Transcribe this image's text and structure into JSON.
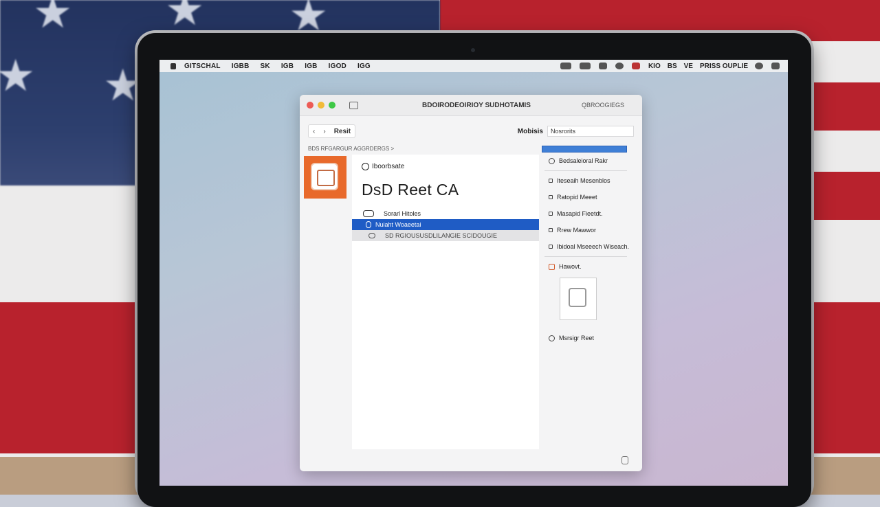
{
  "menubar": {
    "items": [
      "GITSCHAL",
      "IGBB",
      "SK",
      "IGB",
      "IGB",
      "IGOD",
      "IGG"
    ],
    "status_text": [
      "KIO",
      "BS",
      "VE",
      "PRISS OUPLIE"
    ]
  },
  "window": {
    "title": "BDOIRODEOIRIOY SUDHOTAMIS",
    "title_right": "QBROOGIEGS",
    "toolbar": {
      "seg_1": "‹",
      "seg_2": "›",
      "seg_label": "Resit",
      "right_label": "Mobisis",
      "search_value": "Nosrorits"
    },
    "path": "BDS RFGARGUR AGGRDERGS >",
    "content": {
      "heading": "Iboorbsate",
      "title": "DsD Reet CA",
      "rows": [
        {
          "label": "Sorarl Hitoles"
        },
        {
          "label": "Nuiaht Woaeetai"
        },
        {
          "label": "SD RGIOUSUSDLILANGIE SCIDOUGIE"
        }
      ]
    },
    "inspector": {
      "top_item": "Bedsaleioral Rakr",
      "items": [
        "Iteseaih Mesenblos",
        "Ratopid Meeet",
        "Masapid Fieetdt.",
        "Rrew Mawwor",
        "Ibidoal Mseeech Wiseach."
      ],
      "preview_label": "Hawovt.",
      "bottom_item": "Msrsigr Reet"
    }
  },
  "colors": {
    "selection": "#1f5cc5",
    "thumb": "#e8692b"
  }
}
